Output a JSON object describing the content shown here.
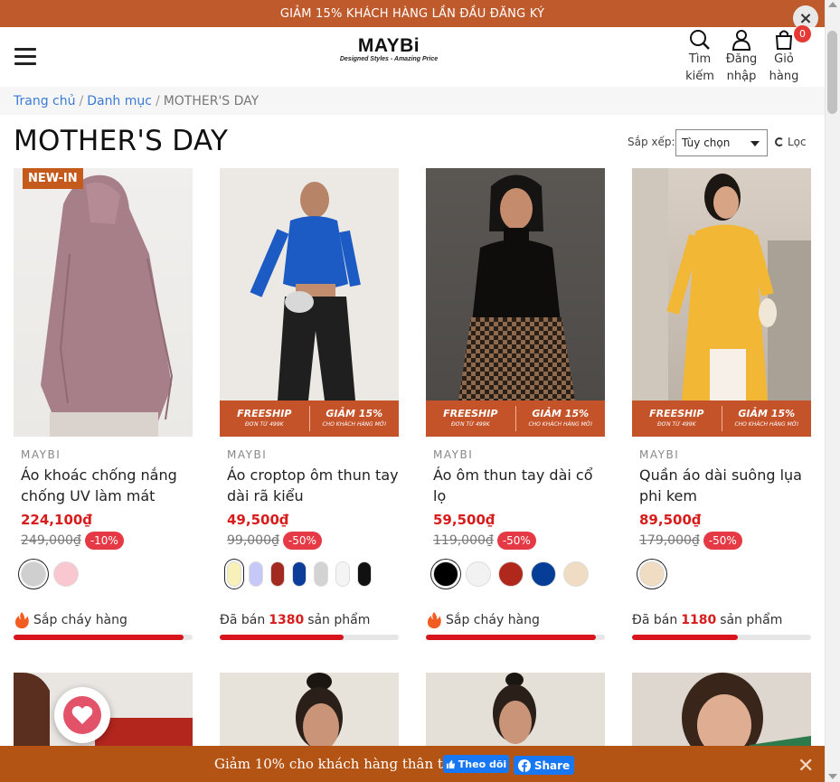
{
  "announcement": {
    "text": "GIẢM 15% KHÁCH HÀNG LẦN ĐẦU ĐĂNG KÝ",
    "close": "×"
  },
  "header": {
    "logo": "MAYBi",
    "tagline": "Designed Styles - Amazing Price",
    "search": "Tìm kiếm",
    "login": "Đăng nhập",
    "cart": "Giỏ hàng",
    "cart_count": "0"
  },
  "breadcrumb": {
    "home": "Trang chủ",
    "sep1": "/",
    "category": "Danh mục",
    "sep2": "/",
    "current": "MOTHER'S DAY"
  },
  "page": {
    "title": "MOTHER'S DAY",
    "sort_label": "Sắp xếp:",
    "sort_value": "Tùy chọn",
    "filter": "Lọc"
  },
  "promo": {
    "freeship": "FREESHIP",
    "freeship_sub": "ĐƠN TỪ 499K",
    "discount": "GIẢM 15%",
    "discount_sub": "CHO KHÁCH HÀNG MỚI"
  },
  "products": [
    {
      "brand": "MAYBI",
      "name": "Áo khoác chống nắng chống UV làm mát",
      "price": "224,100₫",
      "old_price": "249,000₫",
      "discount": "-10%",
      "badge": "NEW-IN",
      "swatches": [
        "#cfcfcf",
        "#f9c7cf"
      ],
      "sold_text": "Sắp cháy hàng",
      "sold_prefix": "",
      "sold_count": "",
      "sold_suffix": "",
      "progress": 0.95
    },
    {
      "brand": "MAYBI",
      "name": "Áo croptop ôm thun tay dài rã kiểu",
      "price": "49,500₫",
      "old_price": "99,000₫",
      "discount": "-50%",
      "badge": "",
      "swatches": [
        "#f7f0b8",
        "#c6c9f7",
        "#a32a21",
        "#0d3d9a",
        "#d3d3d3",
        "#f4f4f4",
        "#111111"
      ],
      "sold_text": "",
      "sold_prefix": "Đã bán",
      "sold_count": "1380",
      "sold_suffix": "sản phẩm",
      "progress": 0.69
    },
    {
      "brand": "MAYBI",
      "name": "Áo ôm thun tay dài cổ lọ",
      "price": "59,500₫",
      "old_price": "119,000₫",
      "discount": "-50%",
      "badge": "",
      "swatches": [
        "#000000",
        "#f2f2f2",
        "#b0281c",
        "#063d96",
        "#efdcc2"
      ],
      "sold_text": "Sắp cháy hàng",
      "sold_prefix": "",
      "sold_count": "",
      "sold_suffix": "",
      "progress": 0.95
    },
    {
      "brand": "MAYBI",
      "name": "Quần áo dài suông lụa phi kem",
      "price": "89,500₫",
      "old_price": "179,000₫",
      "discount": "-50%",
      "badge": "",
      "swatches": [
        "#efdcc2"
      ],
      "sold_text": "",
      "sold_prefix": "Đã bán",
      "sold_count": "1180",
      "sold_suffix": "sản phẩm",
      "progress": 0.59
    }
  ],
  "bottom_bar": {
    "text": "Giảm 10% cho khách hàng thân thiết",
    "follow": "Theo dõi",
    "share": "Share",
    "close": "✕"
  },
  "colors": {
    "accent": "#bf5a2c",
    "price": "#d81b1b",
    "link": "#3a7bd5",
    "bottom": "#b35415"
  }
}
